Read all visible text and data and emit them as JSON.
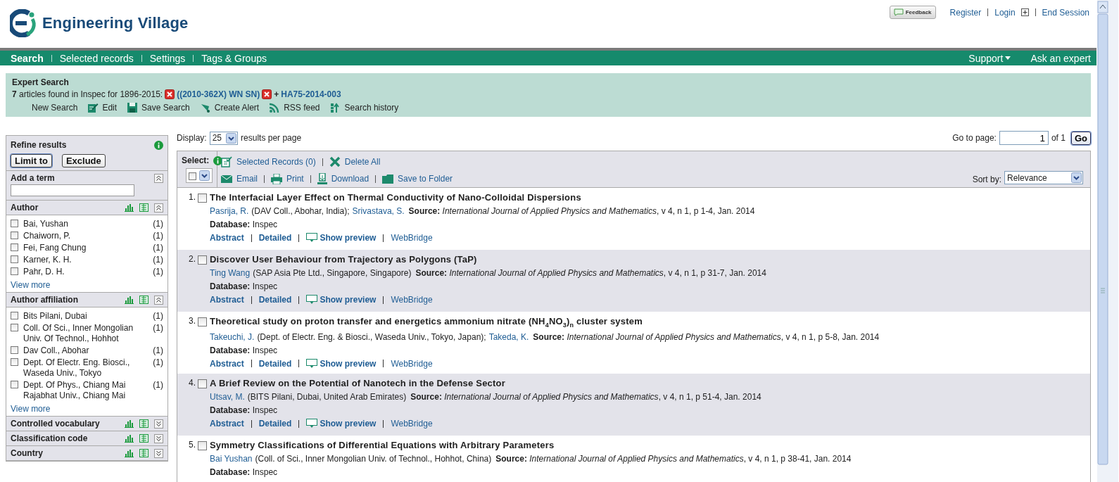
{
  "header": {
    "brand": "Engineering Village",
    "feedback": "Feedback",
    "account_links": [
      {
        "label": "Register"
      },
      {
        "label": "Login"
      },
      {
        "label": "End Session"
      }
    ]
  },
  "nav": {
    "items": [
      {
        "label": "Search",
        "selected": true
      },
      {
        "label": "Selected records",
        "selected": false
      },
      {
        "label": "Settings",
        "selected": false
      },
      {
        "label": "Tags & Groups",
        "selected": false
      }
    ],
    "right": [
      {
        "label": "Support",
        "dropdown": true
      },
      {
        "label": "Ask an expert",
        "dropdown": false
      }
    ]
  },
  "search_summary": {
    "title": "Expert Search",
    "count": "7",
    "found_text": "articles found in Inspec for 1896-2015:",
    "terms": [
      {
        "text": "((2010-362X) WN SN)"
      },
      {
        "operator": "+",
        "text": "HA75-2014-003"
      }
    ],
    "actions": [
      "New Search",
      "Edit",
      "Save Search",
      "Create Alert",
      "RSS feed",
      "Search history"
    ]
  },
  "refine": {
    "title": "Refine results",
    "buttons": [
      "Limit to",
      "Exclude"
    ],
    "sections": [
      {
        "kind": "term",
        "title": "Add a term",
        "expanded": true
      },
      {
        "kind": "facet",
        "title": "Author",
        "expanded": true,
        "items": [
          {
            "label": "Bai, Yushan",
            "count": "(1)",
            "checked": false
          },
          {
            "label": "Chaiworn, P.",
            "count": "(1)",
            "checked": false
          },
          {
            "label": "Fei, Fang Chung",
            "count": "(1)",
            "checked": false
          },
          {
            "label": "Karner, K. H.",
            "count": "(1)",
            "checked": false
          },
          {
            "label": "Pahr, D. H.",
            "count": "(1)",
            "checked": false
          }
        ],
        "more": "View more"
      },
      {
        "kind": "facet",
        "title": "Author affiliation",
        "expanded": true,
        "items": [
          {
            "label": "Bits Pilani, Dubai",
            "count": "(1)",
            "checked": false
          },
          {
            "label": "Coll. Of Sci., Inner Mongolian Univ. Of Technol., Hohhot",
            "count": "(1)",
            "checked": false
          },
          {
            "label": "Dav Coll., Abohar",
            "count": "(1)",
            "checked": false
          },
          {
            "label": "Dept. Of Electr. Eng. Biosci., Waseda Univ., Tokyo",
            "count": "(1)",
            "checked": false
          },
          {
            "label": "Dept. Of Phys., Chiang Mai Rajabhat Univ., Chiang Mai",
            "count": "(1)",
            "checked": false
          }
        ],
        "more": "View more"
      },
      {
        "kind": "facet",
        "title": "Controlled vocabulary",
        "expanded": false
      },
      {
        "kind": "facet",
        "title": "Classification code",
        "expanded": false
      },
      {
        "kind": "facet",
        "title": "Country",
        "expanded": false
      }
    ]
  },
  "results": {
    "display_label": "Display:",
    "per_page": "25",
    "per_page_suffix": "results per page",
    "goto_label": "Go to page:",
    "page": "1",
    "page_of": "of 1",
    "go": "Go",
    "select_label": "Select:",
    "select_all_checked": false,
    "record_actions": [
      [
        "Selected Records (0)",
        "Delete All"
      ],
      [
        "Email",
        "Print",
        "Download",
        "Save to Folder"
      ]
    ],
    "sort_label": "Sort by:",
    "sort_value": "Relevance",
    "records": [
      {
        "number": "1.",
        "checked": false,
        "title": "The Interfacial Layer Effect on Thermal Conductivity of Nano-Colloidal Dispersions",
        "authors": [
          {
            "name": "Pasrija, R.",
            "affiliation": "(DAV Coll., Abohar, India);"
          },
          {
            "name": "Srivastava, S."
          }
        ],
        "source": "**Source:** *International Journal of Applied Physics and Mathematics*, v 4, n 1, p 1-4, Jan. 2014",
        "database": "**Database:** Inspec",
        "links": [
          "Abstract",
          "Detailed",
          "Show preview",
          "WebBridge"
        ]
      },
      {
        "number": "2.",
        "checked": false,
        "title": "Discover User Behaviour from Trajectory as Polygons (TaP)",
        "authors": [
          {
            "name": "Ting Wang",
            "affiliation": "(SAP Asia Pte Ltd., Singapore, Singapore)"
          }
        ],
        "source": "**Source:** *International Journal of Applied Physics and Mathematics*, v 4, n 1, p 31-7, Jan. 2014",
        "database": "**Database:** Inspec",
        "links": [
          "Abstract",
          "Detailed",
          "Show preview",
          "WebBridge"
        ]
      },
      {
        "number": "3.",
        "checked": false,
        "title": "Theoretical study on proton transfer and energetics ammonium nitrate (NH$_{4}$NO$_{3}$)$_{n}$ cluster system",
        "authors": [
          {
            "name": "Takeuchi, J.",
            "affiliation": "(Dept. of Electr. Eng. & Biosci., Waseda Univ., Tokyo, Japan);"
          },
          {
            "name": "Takeda, K."
          }
        ],
        "source": "**Source:** *International Journal of Applied Physics and Mathematics*, v 4, n 1, p 5-8, Jan. 2014",
        "database": "**Database:** Inspec",
        "links": [
          "Abstract",
          "Detailed",
          "Show preview",
          "WebBridge"
        ]
      },
      {
        "number": "4.",
        "checked": false,
        "title": "A Brief Review on the Potential of Nanotech in the Defense Sector",
        "authors": [
          {
            "name": "Utsav, M.",
            "affiliation": "(BITS Pilani, Dubai, United Arab Emirates)"
          }
        ],
        "source": "**Source:** *International Journal of Applied Physics and Mathematics*, v 4, n 1, p 51-4, Jan. 2014",
        "database": "**Database:** Inspec",
        "links": [
          "Abstract",
          "Detailed",
          "Show preview",
          "WebBridge"
        ]
      },
      {
        "number": "5.",
        "checked": false,
        "title": "Symmetry Classifications of Differential Equations with Arbitrary Parameters",
        "authors": [
          {
            "name": "Bai Yushan",
            "affiliation": "(Coll. of Sci., Inner Mongolian Univ. of Technol., Hohhot, China)"
          }
        ],
        "source": "**Source:** *International Journal of Applied Physics and Mathematics*, v 4, n 1, p 38-41, Jan. 2014",
        "database": "**Database:** Inspec"
      }
    ]
  }
}
